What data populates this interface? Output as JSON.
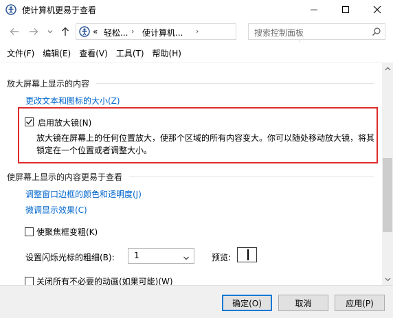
{
  "window": {
    "title": "使计算机更易于查看",
    "icon": "control-panel-icon"
  },
  "address": {
    "prefix": "«",
    "crumb1": "轻松...",
    "crumb2": "使计算机...",
    "search_placeholder": "搜索控制面板"
  },
  "menu": [
    {
      "label": "文件(F)"
    },
    {
      "label": "编辑(E)"
    },
    {
      "label": "查看(V)"
    },
    {
      "label": "工具(T)"
    },
    {
      "label": "帮助(H)"
    }
  ],
  "content": {
    "section1_title": "放大屏幕上显示的内容",
    "link_text_size": "更改文本和图标的大小(Z)",
    "magnifier_label": "启用放大镜(N)",
    "magnifier_checked": true,
    "magnifier_desc": "放大镜在屏幕上的任何位置放大，使那个区域的所有内容变大。你可以随处移动放大镜，将其锁定在一个位置或者调整大小。",
    "section2_title": "使屏幕上显示的内容更易于查看",
    "link_window_border": "调整窗口边框的颜色和透明度(J)",
    "link_fine_tune": "微调显示效果(C)",
    "focus_label": "使聚焦框变粗(K)",
    "cursor_thickness_label": "设置闪烁光标的粗细(B):",
    "cursor_thickness_value": "1",
    "preview_label": "预览:",
    "animation_label": "关闭所有不必要的动画(如果可能)(W)"
  },
  "buttons": {
    "ok": "确定(O)",
    "cancel": "取消",
    "apply": "应用(P)"
  },
  "colors": {
    "link": "#0066cc",
    "highlight": "#e02a2a",
    "accent": "#0078d7"
  }
}
